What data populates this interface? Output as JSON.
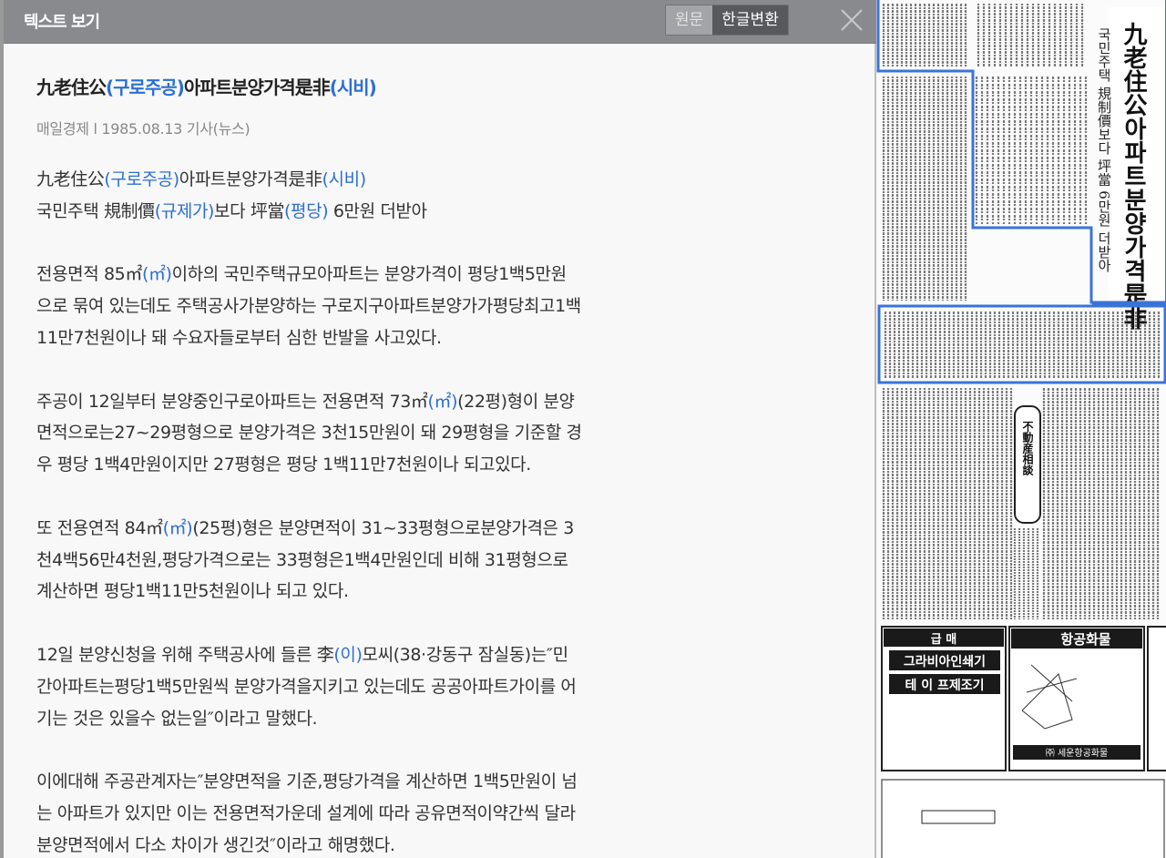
{
  "header": {
    "title": "텍스트 보기",
    "original_label": "원문",
    "convert_label": "한글변환"
  },
  "article": {
    "title_parts": [
      {
        "text": "九老住公",
        "hl": false
      },
      {
        "text": "(구로주공)",
        "hl": true
      },
      {
        "text": "아파트분양가격是非",
        "hl": false
      },
      {
        "text": "(시비)",
        "hl": true
      }
    ],
    "meta": "매일경제 l 1985.08.13 기사(뉴스)",
    "paragraphs": [
      [
        [
          {
            "t": "九老住公",
            "h": false
          },
          {
            "t": "(구로주공)",
            "h": true
          },
          {
            "t": "아파트분양가격是非",
            "h": false
          },
          {
            "t": "(시비)",
            "h": true
          }
        ],
        [
          {
            "t": "국민주택 規制價",
            "h": false
          },
          {
            "t": "(규제가)",
            "h": true
          },
          {
            "t": "보다 坪當",
            "h": false
          },
          {
            "t": "(평당)",
            "h": true
          },
          {
            "t": " 6만원 더받아",
            "h": false
          }
        ]
      ],
      [
        [
          {
            "t": " 전용면적 85㎡",
            "h": false
          },
          {
            "t": "(㎡)",
            "h": true
          },
          {
            "t": "이하의 국민주택규모아파트는 분양가격이 평당1백5만원",
            "h": false
          }
        ],
        [
          {
            "t": "으로 묶여 있는데도 주택공사가분양하는 구로지구아파트분양가가평당최고1백",
            "h": false
          }
        ],
        [
          {
            "t": "11만7천원이나 돼 수요자들로부터 심한 반발을 사고있다.",
            "h": false
          }
        ]
      ],
      [
        [
          {
            "t": " 주공이 12일부터 분양중인구로아파트는 전용면적 73㎡",
            "h": false
          },
          {
            "t": "(㎡)",
            "h": true
          },
          {
            "t": "(22평)형이 분양",
            "h": false
          }
        ],
        [
          {
            "t": "면적으로는27~29평형으로 분양가격은 3천15만원이 돼 29평형을 기준할 경",
            "h": false
          }
        ],
        [
          {
            "t": "우 평당 1백4만원이지만 27평형은 평당 1백11만7천원이나 되고있다.",
            "h": false
          }
        ]
      ],
      [
        [
          {
            "t": " 또 전용연적 84㎡",
            "h": false
          },
          {
            "t": "(㎡)",
            "h": true
          },
          {
            "t": "(25평)형은 분양면적이 31~33평형으로분양가격은 3",
            "h": false
          }
        ],
        [
          {
            "t": "천4백56만4천원,평당가격으로는 33평형은1백4만원인데 비해 31평형으로",
            "h": false
          }
        ],
        [
          {
            "t": "계산하면 평당1백11만5천원이나 되고 있다.",
            "h": false
          }
        ]
      ],
      [
        [
          {
            "t": " 12일 분양신청을 위해 주택공사에 들른 李",
            "h": false
          },
          {
            "t": "(이)",
            "h": true
          },
          {
            "t": "모씨(38·강동구 잠실동)는″민",
            "h": false
          }
        ],
        [
          {
            "t": "간아파트는평당1백5만원씩 분양가격을지키고 있는데도 공공아파트가이를 어",
            "h": false
          }
        ],
        [
          {
            "t": "기는 것은 있을수 없는일″이라고 말했다.",
            "h": false
          }
        ]
      ],
      [
        [
          {
            "t": " 이에대해 주공관계자는″분양면적을 기준,평당가격을 계산하면 1백5만원이 넘",
            "h": false
          }
        ],
        [
          {
            "t": "는 아파트가 있지만 이는 전용면적가운데 설계에 따라 공유면적이약간씩 달라",
            "h": false
          }
        ],
        [
          {
            "t": "분양면적에서 다소 차이가 생긴것″이라고 해명했다.",
            "h": false
          }
        ]
      ]
    ]
  },
  "newspaper": {
    "headline": "九老住公아파트분양가격是非",
    "subhead": "국민주택 規制價보다 坪當 6만원 더받아",
    "column_title": "不動産相談",
    "ad1_title": "급 매",
    "ad1_line1": "그라비아인쇄기",
    "ad1_line2": "테 이 프제조기",
    "ad2_title": "항공화물",
    "ad2_footer": "㈜ 세운항공화물"
  }
}
